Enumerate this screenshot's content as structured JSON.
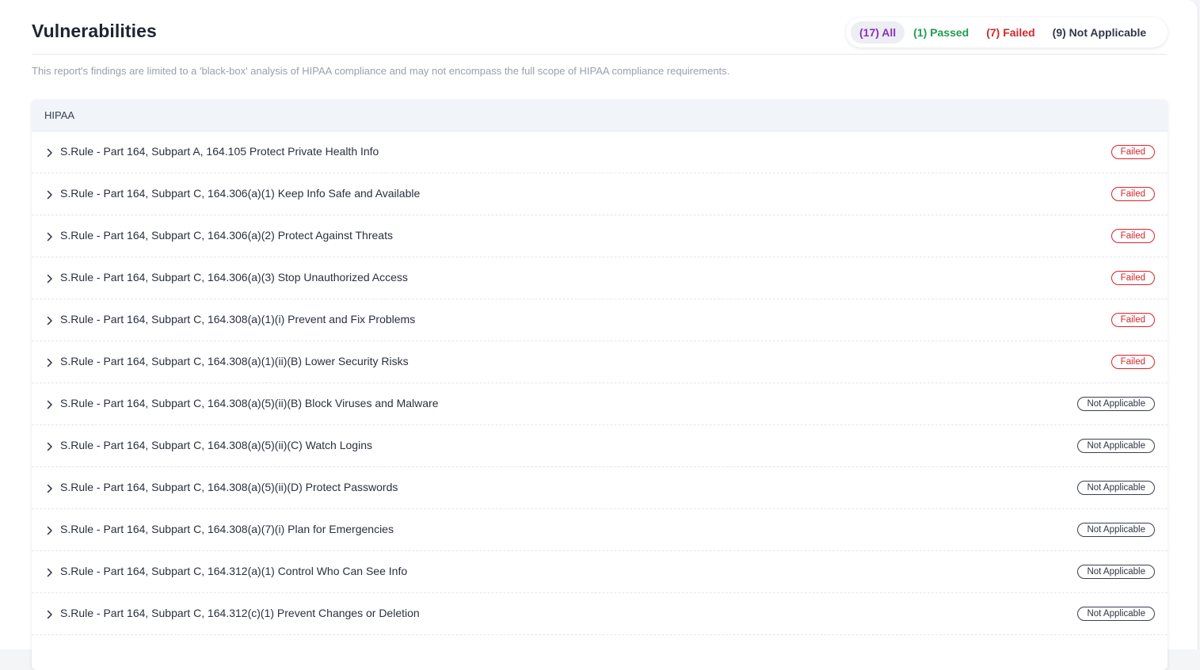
{
  "page": {
    "title": "Vulnerabilities",
    "disclaimer": "This report's findings are limited to a 'black-box' analysis of HIPAA compliance and may not encompass the full scope of HIPAA compliance requirements."
  },
  "filters": [
    {
      "label": "(17) All",
      "status": "all",
      "active": true
    },
    {
      "label": "(1) Passed",
      "status": "passed",
      "active": false
    },
    {
      "label": "(7) Failed",
      "status": "failed",
      "active": false
    },
    {
      "label": "(9) Not Applicable",
      "status": "na",
      "active": false
    }
  ],
  "table": {
    "header": "HIPAA",
    "rows": [
      {
        "label": "S.Rule - Part 164, Subpart A, 164.105 Protect Private Health Info",
        "status": "Failed"
      },
      {
        "label": "S.Rule - Part 164, Subpart C, 164.306(a)(1) Keep Info Safe and Available",
        "status": "Failed"
      },
      {
        "label": "S.Rule - Part 164, Subpart C, 164.306(a)(2) Protect Against Threats",
        "status": "Failed"
      },
      {
        "label": "S.Rule - Part 164, Subpart C, 164.306(a)(3) Stop Unauthorized Access",
        "status": "Failed"
      },
      {
        "label": "S.Rule - Part 164, Subpart C, 164.308(a)(1)(i) Prevent and Fix Problems",
        "status": "Failed"
      },
      {
        "label": "S.Rule - Part 164, Subpart C, 164.308(a)(1)(ii)(B) Lower Security Risks",
        "status": "Failed"
      },
      {
        "label": "S.Rule - Part 164, Subpart C, 164.308(a)(5)(ii)(B) Block Viruses and Malware",
        "status": "Not Applicable"
      },
      {
        "label": "S.Rule - Part 164, Subpart C, 164.308(a)(5)(ii)(C) Watch Logins",
        "status": "Not Applicable"
      },
      {
        "label": "S.Rule - Part 164, Subpart C, 164.308(a)(5)(ii)(D) Protect Passwords",
        "status": "Not Applicable"
      },
      {
        "label": "S.Rule - Part 164, Subpart C, 164.308(a)(7)(i) Plan for Emergencies",
        "status": "Not Applicable"
      },
      {
        "label": "S.Rule - Part 164, Subpart C, 164.312(a)(1) Control Who Can See Info",
        "status": "Not Applicable"
      },
      {
        "label": "S.Rule - Part 164, Subpart C, 164.312(c)(1) Prevent Changes or Deletion",
        "status": "Not Applicable"
      }
    ]
  },
  "icons": {
    "row_expand": "chevron-right-icon"
  },
  "colors": {
    "all": "#8a2fbd",
    "passed": "#1e9d4f",
    "failed": "#d3262b",
    "not_applicable": "#323845"
  }
}
